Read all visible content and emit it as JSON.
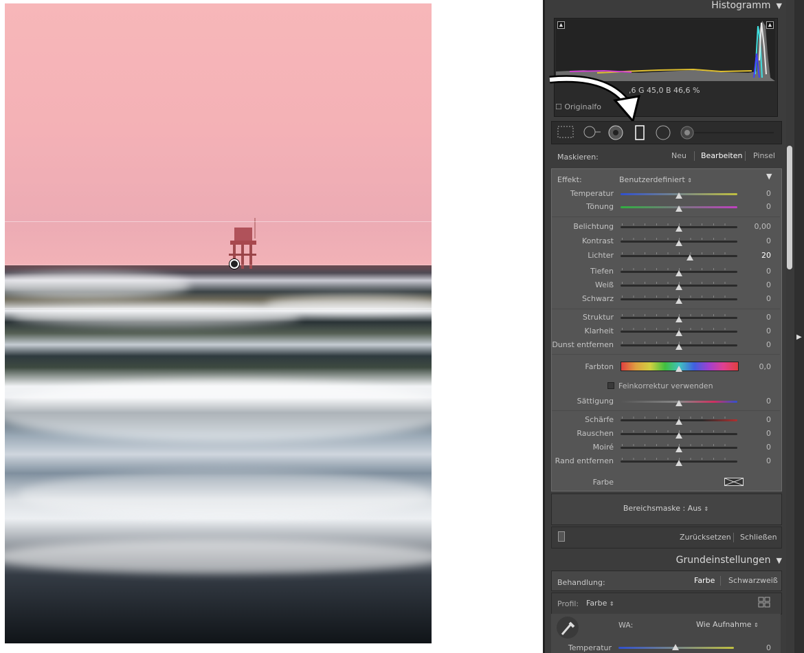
{
  "panel": {
    "histogram_title": "Histogramm",
    "rgb_readout": "R  6,6  G  45,0  B  46,6 %",
    "rgb_readout_visible": ",6   G   45,0   B   46,6 %",
    "original_label": "Originalfo",
    "mask": {
      "label": "Maskieren:",
      "new": "Neu",
      "edit": "Bearbeiten",
      "brush": "Pinsel"
    },
    "effect": {
      "label": "Effekt:",
      "value": "Benutzerdefiniert"
    },
    "sliders": [
      {
        "label": "Temperatur",
        "value": "0"
      },
      {
        "label": "Tönung",
        "value": "0"
      },
      {
        "label": "Belichtung",
        "value": "0,00"
      },
      {
        "label": "Kontrast",
        "value": "0"
      },
      {
        "label": "Lichter",
        "value": "20"
      },
      {
        "label": "Tiefen",
        "value": "0"
      },
      {
        "label": "Weiß",
        "value": "0"
      },
      {
        "label": "Schwarz",
        "value": "0"
      },
      {
        "label": "Struktur",
        "value": "0"
      },
      {
        "label": "Klarheit",
        "value": "0"
      },
      {
        "label": "Dunst entfernen",
        "value": "0"
      },
      {
        "label": "Farbton",
        "value": "0,0"
      },
      {
        "label": "Sättigung",
        "value": "0"
      },
      {
        "label": "Schärfe",
        "value": "0"
      },
      {
        "label": "Rauschen",
        "value": "0"
      },
      {
        "label": "Moiré",
        "value": "0"
      },
      {
        "label": "Rand entfernen",
        "value": "0"
      }
    ],
    "fine_tune_label": "Feinkorrektur verwenden",
    "color_label": "Farbe",
    "range_mask": "Bereichsmaske : Aus",
    "reset": "Zurücksetzen",
    "close": "Schließen",
    "basic_title": "Grundeinstellungen",
    "treatment": {
      "label": "Behandlung:",
      "color": "Farbe",
      "bw": "Schwarzweiß"
    },
    "profile": {
      "label": "Profil:",
      "value": "Farbe"
    },
    "wb": {
      "label": "WA:",
      "value": "Wie Aufnahme"
    },
    "temp2": {
      "label": "Temperatur",
      "value": "0"
    }
  }
}
